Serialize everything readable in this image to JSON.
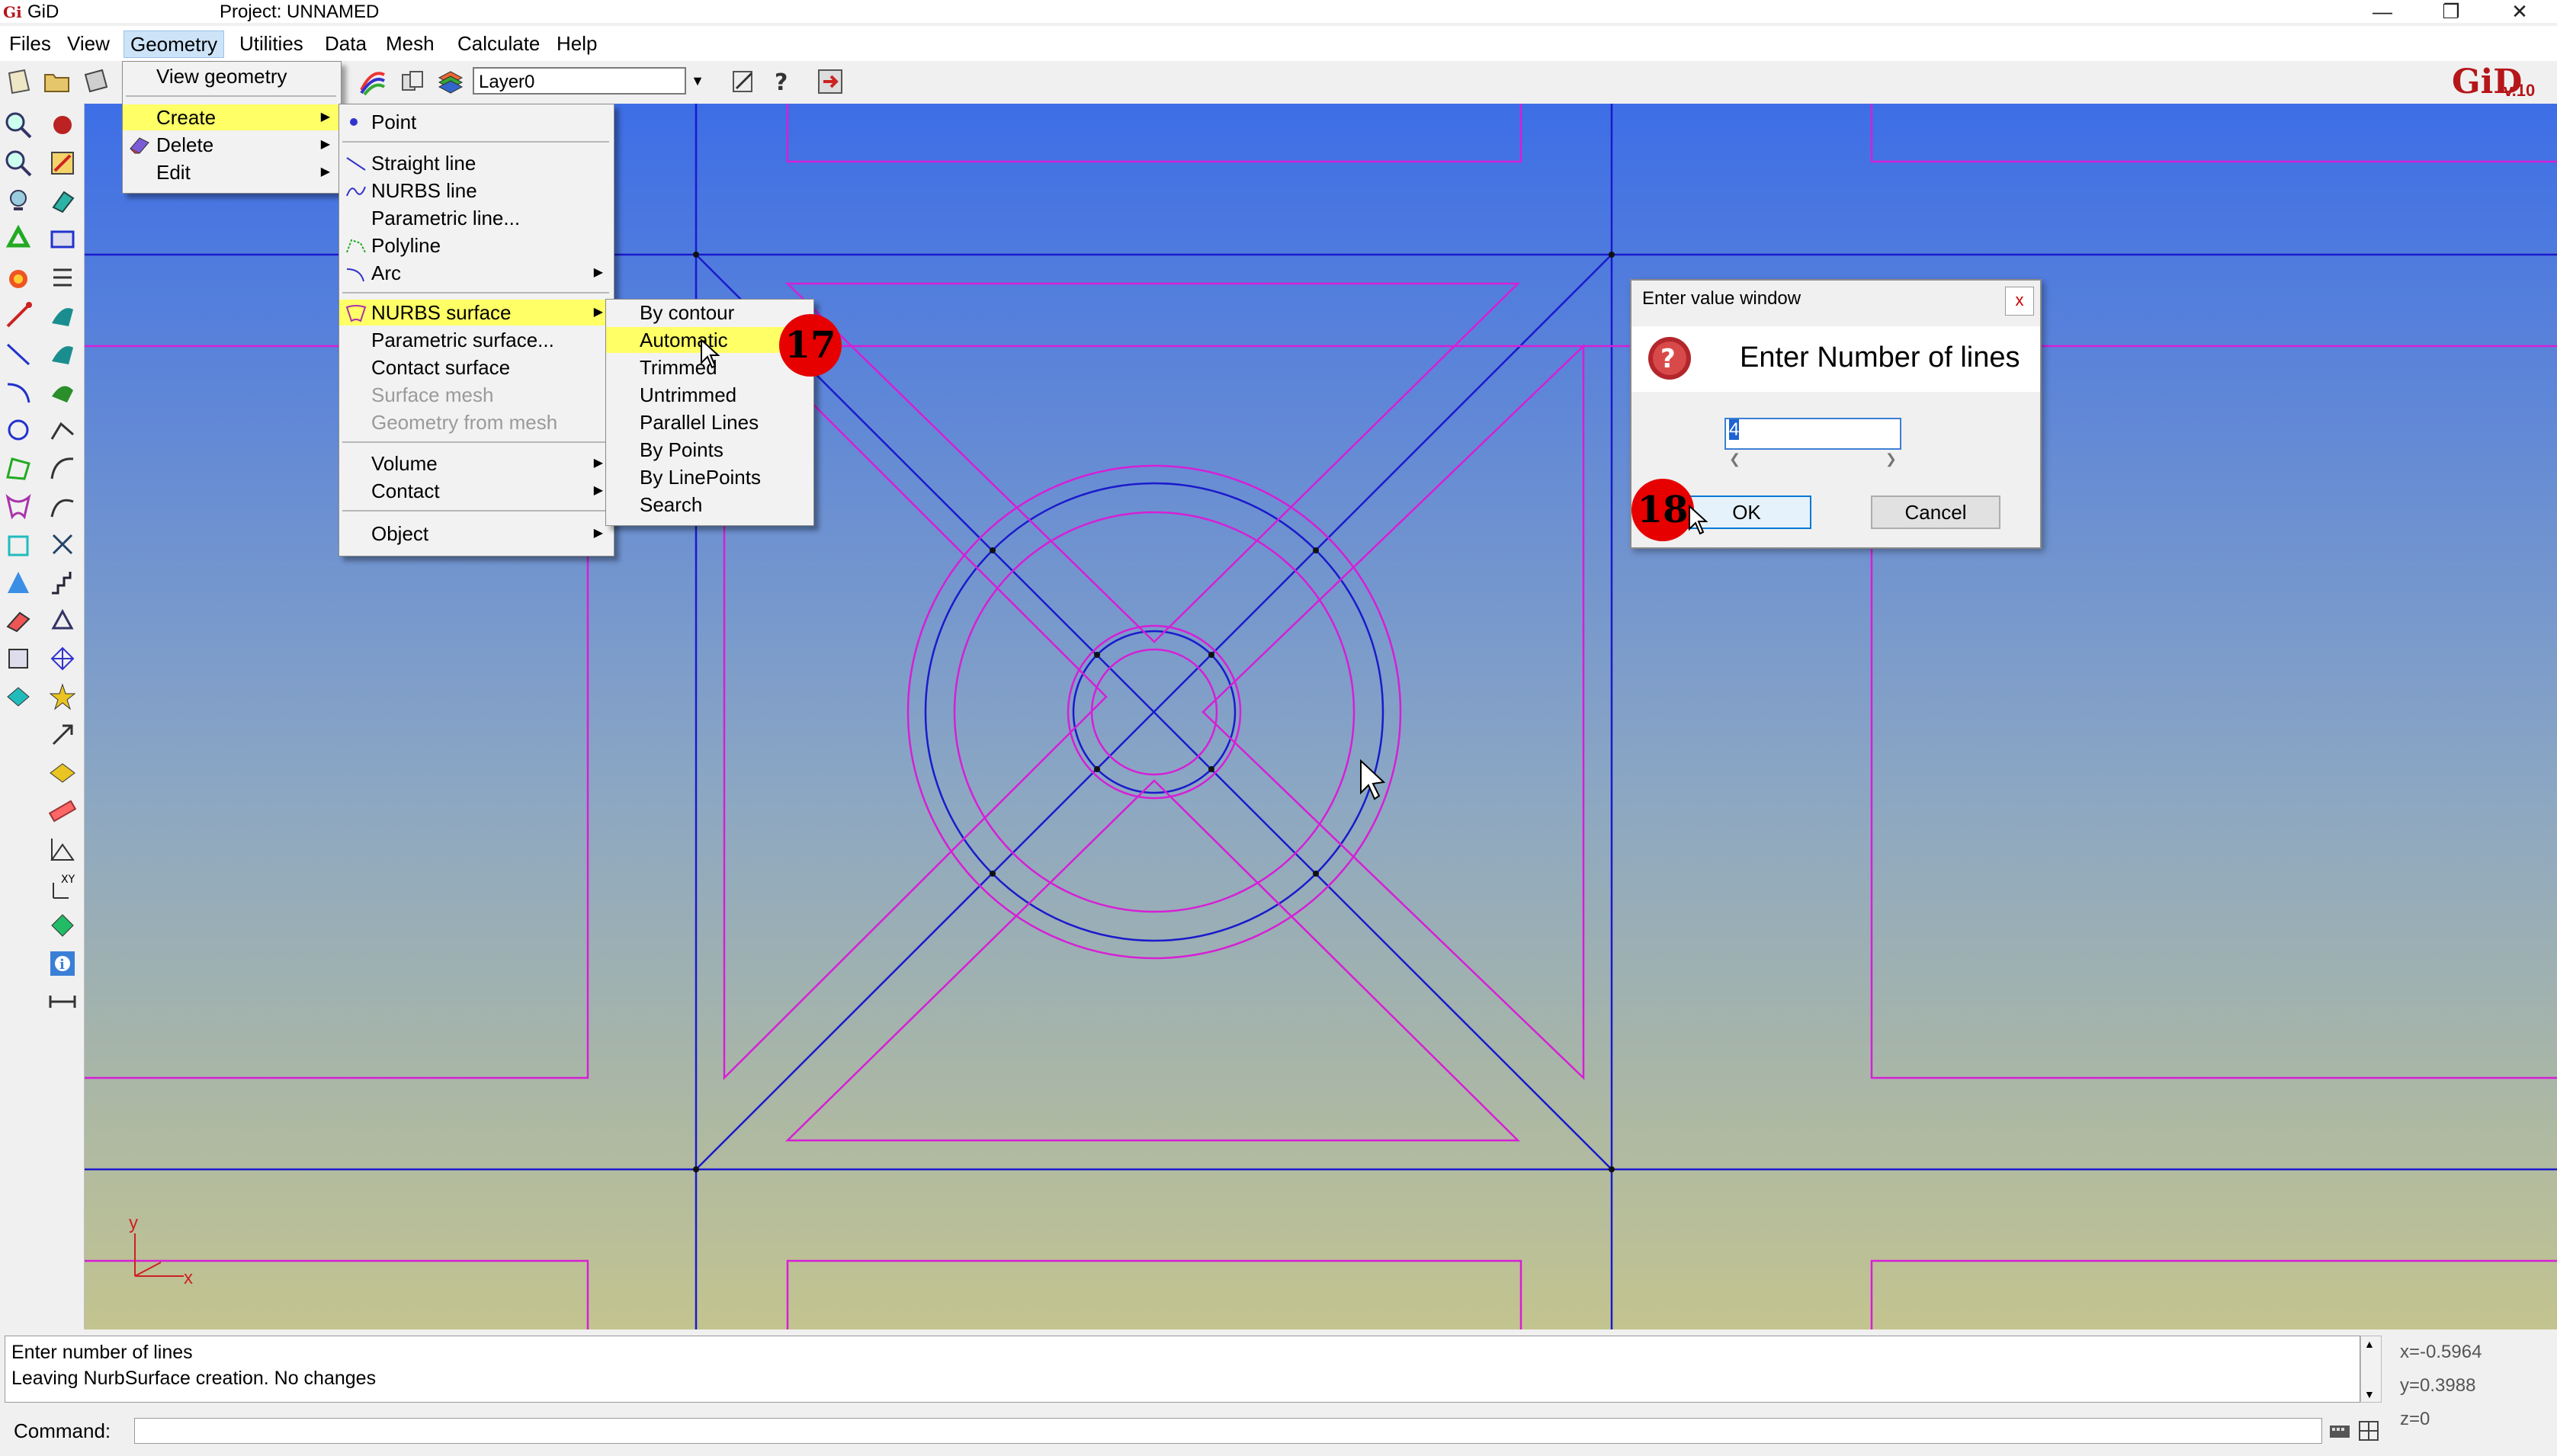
{
  "window": {
    "app_name": "GiD",
    "project_title": "Project: UNNAMED",
    "controls": [
      "minimize",
      "restore",
      "close"
    ]
  },
  "menubar": [
    "Files",
    "View",
    "Geometry",
    "Utilities",
    "Data",
    "Mesh",
    "Calculate",
    "Help"
  ],
  "toolbar": {
    "layer": "Layer0",
    "logo": "GiD",
    "version": "v.10"
  },
  "geometry_menu": [
    "View geometry",
    "Create",
    "Delete",
    "Edit"
  ],
  "create_menu": {
    "point": "Point",
    "lines": [
      "Straight line",
      "NURBS line",
      "Parametric line...",
      "Polyline",
      "Arc"
    ],
    "surfaces": [
      "NURBS surface",
      "Parametric surface...",
      "Contact surface",
      "Surface mesh",
      "Geometry from mesh"
    ],
    "others": [
      "Volume",
      "Contact"
    ],
    "object": "Object"
  },
  "nurbs_menu": [
    "By contour",
    "Automatic",
    "Trimmed",
    "Untrimmed",
    "Parallel Lines",
    "By Points",
    "By LinePoints",
    "Search"
  ],
  "badges": {
    "step17": "17",
    "step18": "18"
  },
  "dialog": {
    "title": "Enter value window",
    "close": "x",
    "prompt": "Enter Number of lines",
    "value": "4",
    "ok": "OK",
    "cancel": "Cancel"
  },
  "status": {
    "line1": "Enter number of lines",
    "line2": "Leaving NurbSurface creation. No changes",
    "x": "x=-0.5964",
    "y": "y=0.3988",
    "z": "z=0"
  },
  "command": {
    "label": "Command:"
  },
  "axes": {
    "x": "x",
    "y": "y"
  },
  "colors": {
    "line_blue": "#1a1acc",
    "surface_magenta": "#d61fd6",
    "highlight": "#ffff66",
    "badge": "#e60000"
  }
}
